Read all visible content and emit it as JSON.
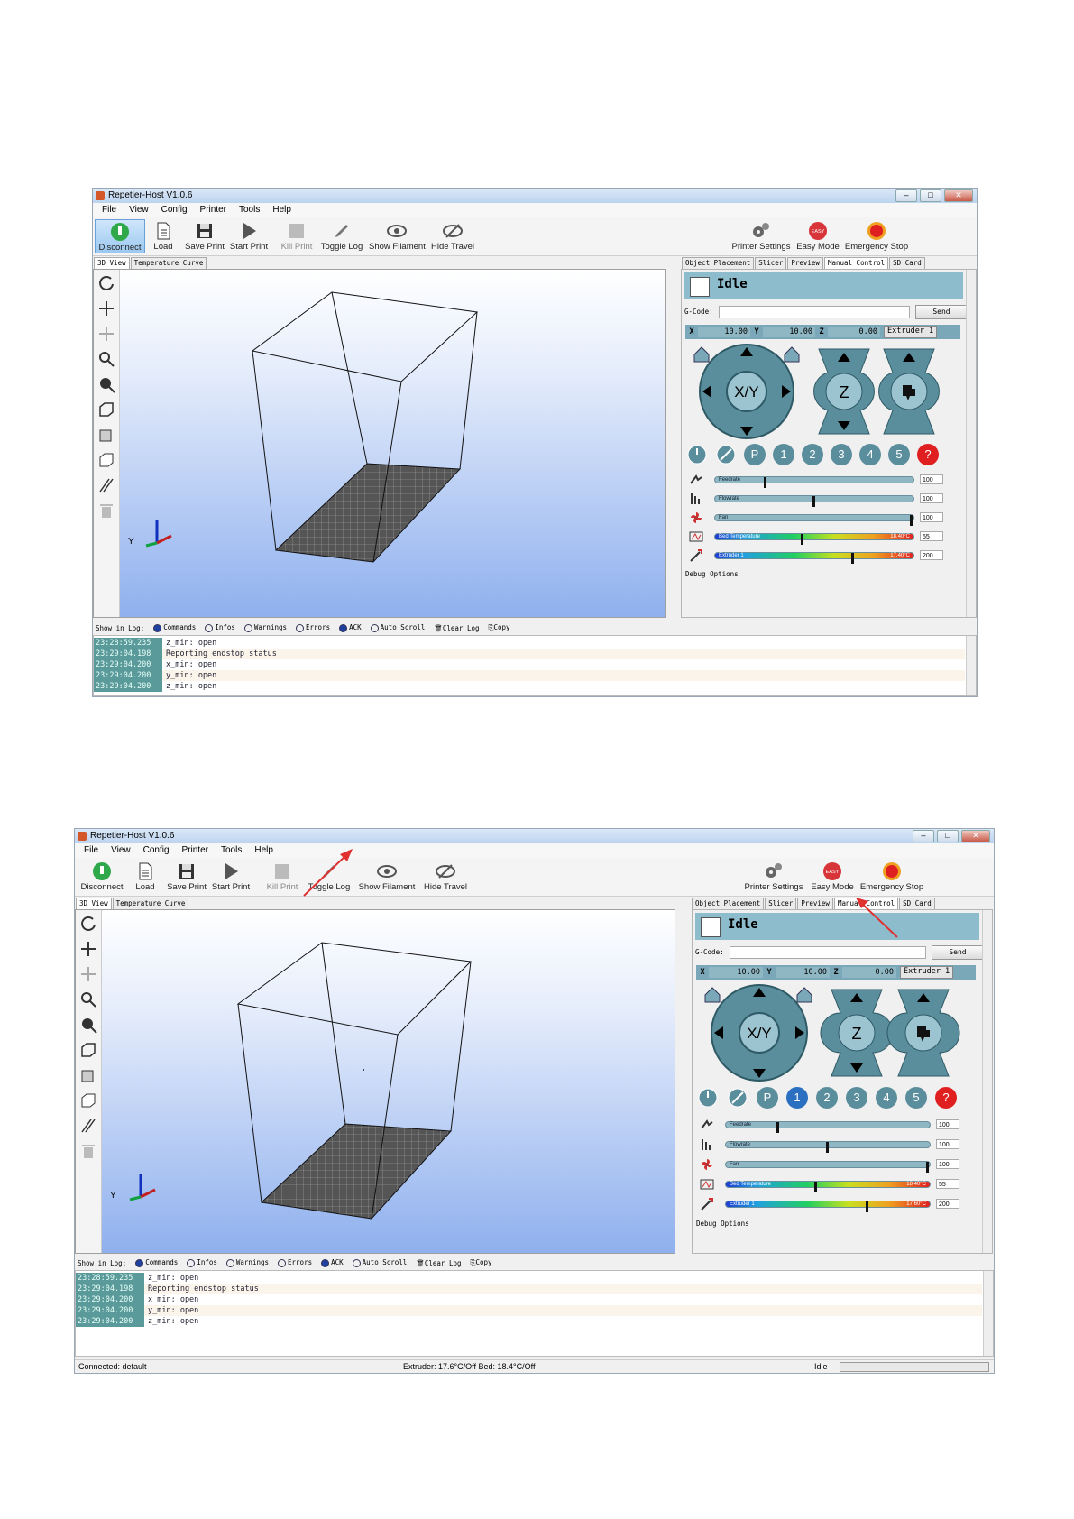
{
  "window": {
    "title": "Repetier-Host V1.0.6"
  },
  "menu": [
    "File",
    "View",
    "Config",
    "Printer",
    "Tools",
    "Help"
  ],
  "toolbar": {
    "disconnect": "Disconnect",
    "load": "Load",
    "save_print": "Save Print",
    "start_print": "Start Print",
    "kill_print": "Kill Print",
    "toggle_log": "Toggle Log",
    "show_filament": "Show Filament",
    "hide_travel": "Hide Travel",
    "printer_settings": "Printer Settings",
    "easy_mode": "Easy Mode",
    "easy_badge": "EASY",
    "emergency_stop": "Emergency Stop"
  },
  "view_tabs": [
    "3D View",
    "Temperature Curve"
  ],
  "right_tabs": [
    "Object Placement",
    "Slicer",
    "Preview",
    "Manual Control",
    "SD Card"
  ],
  "manual": {
    "status": "Idle",
    "gcode_label": "G-Code:",
    "send": "Send",
    "x_label": "X",
    "x_value": "10.00",
    "y_label": "Y",
    "y_value": "10.00",
    "z_label": "Z",
    "z_value": "0.00",
    "extruder_select": "Extruder 1",
    "xy_label": "X/Y",
    "z_pad_label": "Z",
    "preset_buttons": [
      "P",
      "1",
      "2",
      "3",
      "4",
      "5",
      "?"
    ],
    "feedrate_label": "Feedrate",
    "feedrate_value": "100",
    "feedrate_level": 0.25,
    "flowrate_label": "Flowrate",
    "flowrate_value": "100",
    "flowrate_level": 0.5,
    "fan_label": "Fan",
    "fan_value": "100",
    "fan_level": 1.0,
    "bed_label": "Bed Temperature",
    "bed_value": "55",
    "bed_level": 0.44,
    "bed_reading_1": "18.40°C",
    "bed_reading_2": "18.40°C",
    "extruder_label": "Extruder 1",
    "extruder_value": "200",
    "extruder_level": 0.7,
    "extruder_reading_1": "17.40°C",
    "extruder_reading_2": "17.60°C",
    "debug": "Debug Options"
  },
  "log": {
    "show_in_log": "Show in Log:",
    "options": [
      "Commands",
      "Infos",
      "Warnings",
      "Errors",
      "ACK",
      "Auto Scroll"
    ],
    "checked": [
      "Commands",
      "ACK"
    ],
    "clear": "Clear Log",
    "copy": "Copy",
    "rows": [
      {
        "time": "23:28:59.235",
        "msg": "z_min: open"
      },
      {
        "time": "23:29:04.198",
        "msg": "Reporting endstop status"
      },
      {
        "time": "23:29:04.200",
        "msg": "x_min: open"
      },
      {
        "time": "23:29:04.200",
        "msg": "y_min: open"
      },
      {
        "time": "23:29:04.200",
        "msg": "z_min: open"
      }
    ]
  },
  "statusbar": {
    "connection": "Connected: default",
    "temps": "Extruder: 17.6°C/Off Bed: 18.4°C/Off",
    "state": "Idle"
  },
  "axis_label": "Y",
  "colors": {
    "accent": "#8dbccd",
    "annotation": "#e03030",
    "estop": "#e02020"
  }
}
